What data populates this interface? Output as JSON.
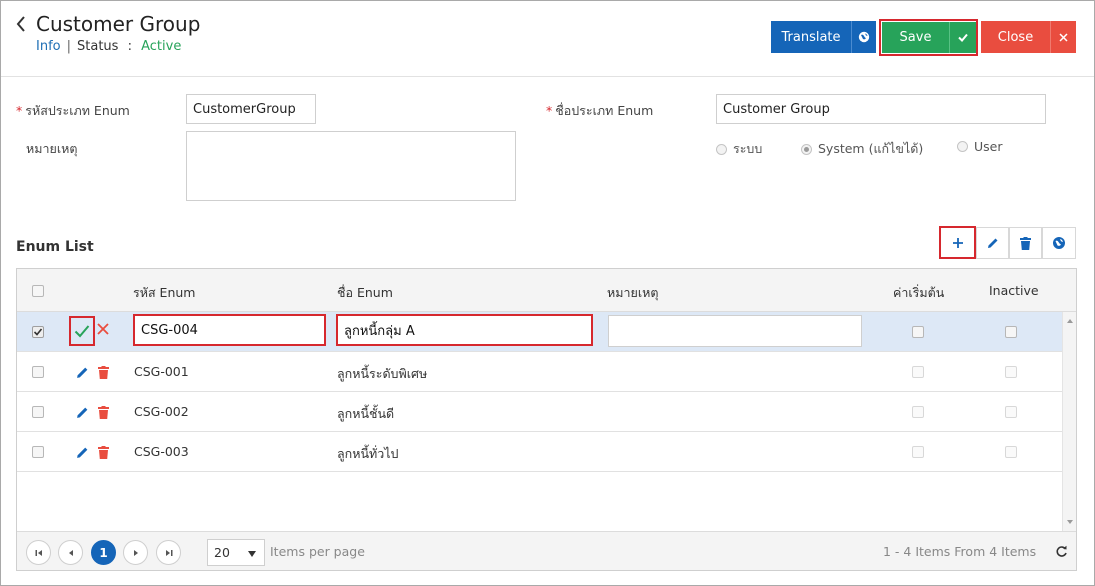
{
  "header": {
    "title": "Customer Group",
    "info_link": "Info",
    "status_label": "Status",
    "status_colon": ":",
    "status_value": "Active"
  },
  "toolbar": {
    "translate_label": "Translate",
    "save_label": "Save",
    "close_label": "Close"
  },
  "form": {
    "enum_code_label": "รหัสประเภท Enum",
    "enum_code_value": "CustomerGroup",
    "enum_name_label": "ชื่อประเภท Enum",
    "enum_name_value": "Customer Group",
    "remark_label": "หมายเหตุ",
    "remark_value": "",
    "required_mark": "*",
    "type_options": [
      "ระบบ",
      "System (แก้ไขได้)",
      "User"
    ],
    "type_selected": "System (แก้ไขได้)"
  },
  "enum_list": {
    "title": "Enum List",
    "columns": [
      "รหัส Enum",
      "ชื่อ Enum",
      "หมายเหตุ",
      "ค่าเริ่มต้น",
      "Inactive"
    ],
    "editing_row": {
      "code": "CSG-004",
      "name": "ลูกหนี้กลุ่ม A",
      "remark": ""
    },
    "rows": [
      {
        "code": "CSG-001",
        "name": "ลูกหนี้ระดับพิเศษ"
      },
      {
        "code": "CSG-002",
        "name": "ลูกหนี้ชั้นดี"
      },
      {
        "code": "CSG-003",
        "name": "ลูกหนี้ทั่วไป"
      }
    ]
  },
  "pager": {
    "current_page": "1",
    "page_size": "20",
    "items_per_page_label": "Items per page",
    "summary": "1 - 4 Items From 4 Items"
  },
  "colors": {
    "primary": "#1565b8",
    "success": "#27a35a",
    "danger": "#e94d3f",
    "highlight": "#d6282e"
  }
}
